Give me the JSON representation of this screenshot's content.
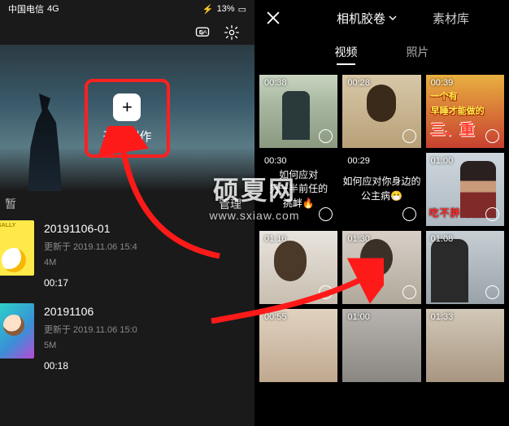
{
  "status_bar": {
    "carrier": "中国电信",
    "signal": "4G",
    "battery_pct": "13%"
  },
  "top_icons": {
    "qa": "qa-icon",
    "settings": "gear-icon"
  },
  "create": {
    "label": "开始创作",
    "plus": "+"
  },
  "drafts_header": {
    "left": "暂",
    "manage": "管理"
  },
  "drafts": [
    {
      "title": "20191106-01",
      "updated": "更新于  2019.11.06  15:4",
      "size": "4M",
      "duration": "00:17"
    },
    {
      "title": "20191106",
      "updated": "更新于  2019.11.06  15:0",
      "size": "5M",
      "duration": "00:18"
    }
  ],
  "right_tabs": {
    "roll": "相机胶卷",
    "lib": "素材库"
  },
  "sub_tabs": {
    "video": "视频",
    "photo": "照片"
  },
  "cells": [
    {
      "dur": "00:38"
    },
    {
      "dur": "00:28"
    },
    {
      "dur": "00:39",
      "line1": "一个有",
      "line2": "早睡才能做的",
      "line3": "三、重"
    },
    {
      "dur": "00:30",
      "text": true,
      "line1": "如何应对",
      "line2": "另一半前任的",
      "line3": "挑衅🔥"
    },
    {
      "dur": "00:29",
      "text": true,
      "line1": "如何应对你身边的",
      "line2": "",
      "line3": "公主病😷"
    },
    {
      "dur": "01:00",
      "sub": "吃不胖的秘密"
    },
    {
      "dur": "01:16"
    },
    {
      "dur": "01:30"
    },
    {
      "dur": "01:08"
    },
    {
      "dur": "00:55"
    },
    {
      "dur": "01:00"
    },
    {
      "dur": "01:33"
    }
  ],
  "watermark": {
    "cn": "硕夏网",
    "url": "www.sxiaw.com"
  }
}
